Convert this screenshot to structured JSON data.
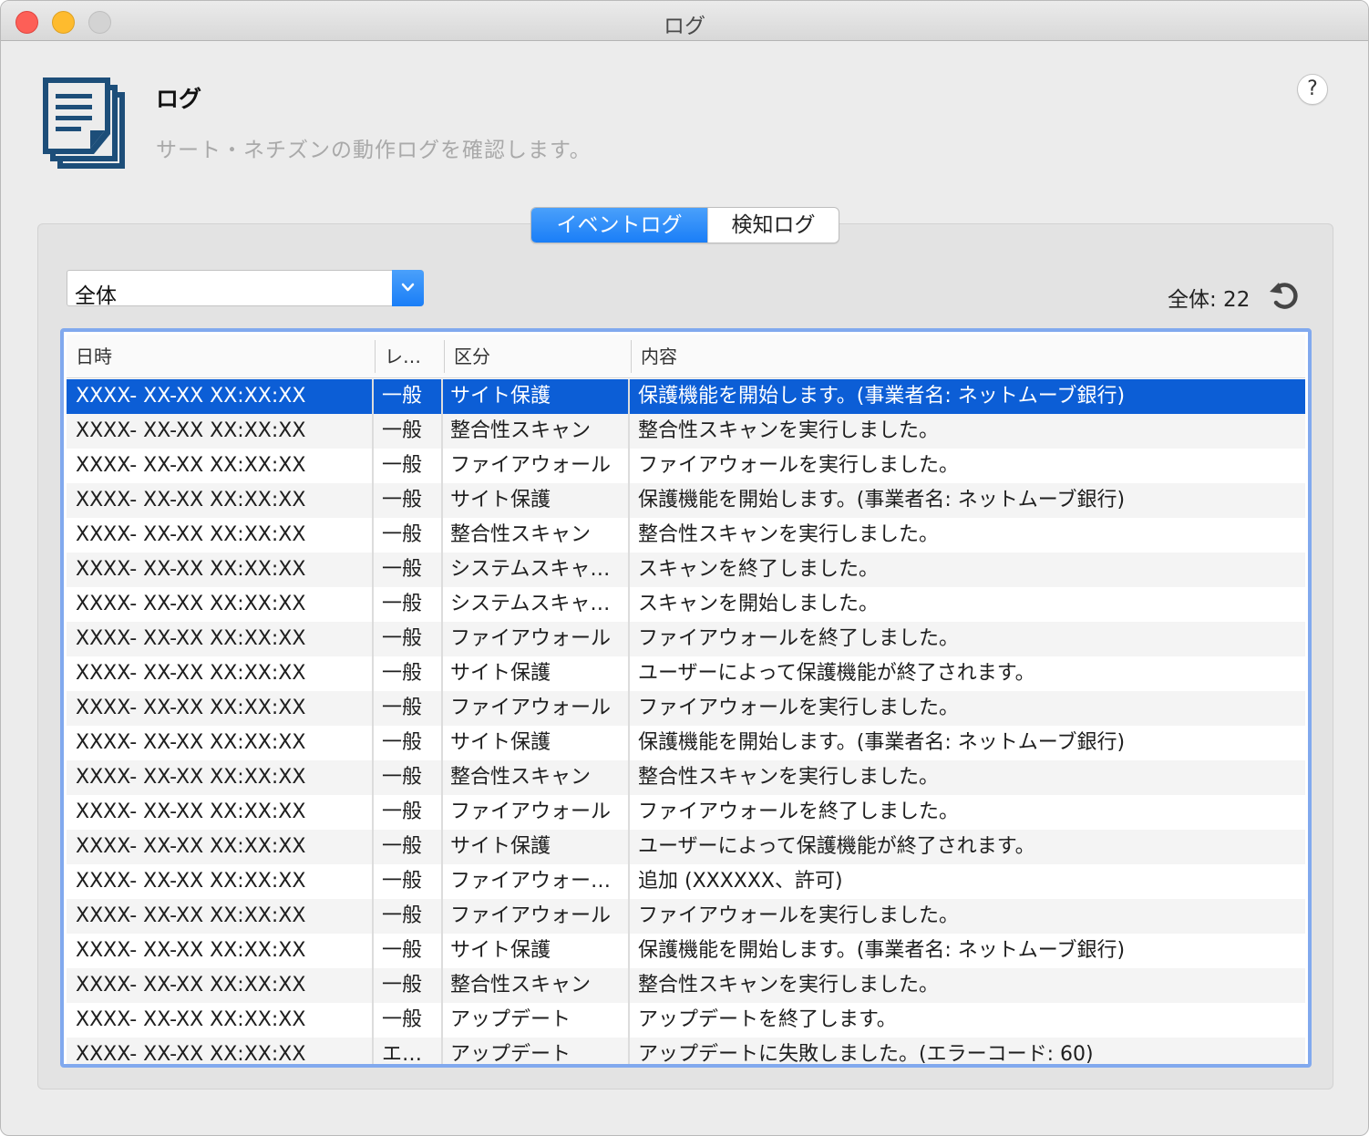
{
  "window": {
    "title": "ログ"
  },
  "header": {
    "title": "ログ",
    "subtitle": "サート・ネチズンの動作ログを確認します。",
    "help_label": "?"
  },
  "tabs": [
    {
      "label": "イベントログ",
      "active": true
    },
    {
      "label": "検知ログ",
      "active": false
    }
  ],
  "filter": {
    "selected": "全体"
  },
  "summary": {
    "count_label": "全体: 22"
  },
  "table": {
    "columns": [
      "日時",
      "レ…",
      "区分",
      "内容"
    ],
    "rows": [
      {
        "datetime": "XXXX- XX-XX XX:XX:XX",
        "level": "一般",
        "category": "サイト保護",
        "content": "保護機能を開始します。(事業者名: ネットムーブ銀行)",
        "selected": true
      },
      {
        "datetime": "XXXX- XX-XX XX:XX:XX",
        "level": "一般",
        "category": "整合性スキャン",
        "content": "整合性スキャンを実行しました。"
      },
      {
        "datetime": "XXXX- XX-XX XX:XX:XX",
        "level": "一般",
        "category": "ファイアウォール",
        "content": "ファイアウォールを実行しました。"
      },
      {
        "datetime": "XXXX- XX-XX XX:XX:XX",
        "level": "一般",
        "category": "サイト保護",
        "content": "保護機能を開始します。(事業者名: ネットムーブ銀行)"
      },
      {
        "datetime": "XXXX- XX-XX XX:XX:XX",
        "level": "一般",
        "category": "整合性スキャン",
        "content": "整合性スキャンを実行しました。"
      },
      {
        "datetime": "XXXX- XX-XX XX:XX:XX",
        "level": "一般",
        "category": "システムスキャ…",
        "content": "スキャンを終了しました。"
      },
      {
        "datetime": "XXXX- XX-XX XX:XX:XX",
        "level": "一般",
        "category": "システムスキャ…",
        "content": "スキャンを開始しました。"
      },
      {
        "datetime": "XXXX- XX-XX XX:XX:XX",
        "level": "一般",
        "category": "ファイアウォール",
        "content": "ファイアウォールを終了しました。"
      },
      {
        "datetime": "XXXX- XX-XX XX:XX:XX",
        "level": "一般",
        "category": "サイト保護",
        "content": "ユーザーによって保護機能が終了されます。"
      },
      {
        "datetime": "XXXX- XX-XX XX:XX:XX",
        "level": "一般",
        "category": "ファイアウォール",
        "content": "ファイアウォールを実行しました。"
      },
      {
        "datetime": "XXXX- XX-XX XX:XX:XX",
        "level": "一般",
        "category": "サイト保護",
        "content": "保護機能を開始します。(事業者名: ネットムーブ銀行)"
      },
      {
        "datetime": "XXXX- XX-XX XX:XX:XX",
        "level": "一般",
        "category": "整合性スキャン",
        "content": "整合性スキャンを実行しました。"
      },
      {
        "datetime": "XXXX- XX-XX XX:XX:XX",
        "level": "一般",
        "category": "ファイアウォール",
        "content": "ファイアウォールを終了しました。"
      },
      {
        "datetime": "XXXX- XX-XX XX:XX:XX",
        "level": "一般",
        "category": "サイト保護",
        "content": "ユーザーによって保護機能が終了されます。"
      },
      {
        "datetime": "XXXX- XX-XX XX:XX:XX",
        "level": "一般",
        "category": "ファイアウォー…",
        "content": "追加 (XXXXXX、許可)"
      },
      {
        "datetime": "XXXX- XX-XX XX:XX:XX",
        "level": "一般",
        "category": "ファイアウォール",
        "content": "ファイアウォールを実行しました。"
      },
      {
        "datetime": "XXXX- XX-XX XX:XX:XX",
        "level": "一般",
        "category": "サイト保護",
        "content": "保護機能を開始します。(事業者名: ネットムーブ銀行)"
      },
      {
        "datetime": "XXXX- XX-XX XX:XX:XX",
        "level": "一般",
        "category": "整合性スキャン",
        "content": "整合性スキャンを実行しました。"
      },
      {
        "datetime": "XXXX- XX-XX XX:XX:XX",
        "level": "一般",
        "category": "アップデート",
        "content": "アップデートを終了します。"
      },
      {
        "datetime": "XXXX- XX-XX XX:XX:XX",
        "level": "エ…",
        "category": "アップデート",
        "content": "アップデートに失敗しました。(エラーコード: 60)"
      }
    ]
  },
  "colors": {
    "accent": "#1a7ef7",
    "selection": "#0c5ed6",
    "focus_ring": "#81a9ee",
    "icon": "#1d4e79"
  },
  "icons": {
    "app": "document-stack-icon",
    "refresh": "refresh-icon",
    "dropdown": "chevron-down-icon"
  }
}
